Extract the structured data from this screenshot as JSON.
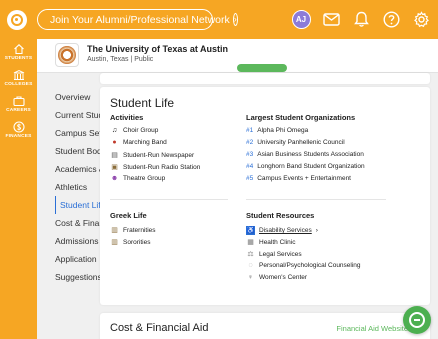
{
  "topbar": {
    "network_link": "Join Your Alumni/Professional Network",
    "avatar_initials": "AJ",
    "brand_color": "#f6a623"
  },
  "rail": {
    "items": [
      {
        "label": "STUDENTS",
        "icon": "home-icon"
      },
      {
        "label": "COLLEGES",
        "icon": "college-icon"
      },
      {
        "label": "CAREERS",
        "icon": "briefcase-icon"
      },
      {
        "label": "FINANCES",
        "icon": "dollar-icon"
      }
    ]
  },
  "school": {
    "name": "The University of Texas at Austin",
    "subtitle": "Austin, Texas | Public"
  },
  "section_nav": {
    "items": [
      "Overview",
      "Current Stude",
      "Campus Setti",
      "Student Body",
      "Academics &",
      "Athletics",
      "Student Life",
      "Cost & Financ",
      "Admissions",
      "Application",
      "Suggestions"
    ],
    "active_index": 6
  },
  "student_life": {
    "title": "Student Life",
    "activities": {
      "heading": "Activities",
      "items": [
        "Choir Group",
        "Marching Band",
        "Student-Run Newspaper",
        "Student-Run Radio Station",
        "Theatre Group"
      ]
    },
    "organizations": {
      "heading": "Largest Student Organizations",
      "items": [
        {
          "num": "#1",
          "name": "Alpha Phi Omega"
        },
        {
          "num": "#2",
          "name": "University Panhellenic Council"
        },
        {
          "num": "#3",
          "name": "Asian Business Students Association"
        },
        {
          "num": "#4",
          "name": "Longhorn Band Student Organization"
        },
        {
          "num": "#5",
          "name": "Campus Events + Entertainment"
        }
      ]
    },
    "greek": {
      "heading": "Greek Life",
      "items": [
        "Fraternities",
        "Sororities"
      ]
    },
    "resources": {
      "heading": "Student Resources",
      "items": [
        "Disability Services",
        "Health Clinic",
        "Legal Services",
        "Personal/Psychological Counseling",
        "Women's Center"
      ]
    }
  },
  "cost": {
    "title": "Cost & Financial Aid",
    "link": "Financial Aid Website"
  },
  "accent_blue": "#2a6fd6",
  "accent_green": "#5cb85c"
}
